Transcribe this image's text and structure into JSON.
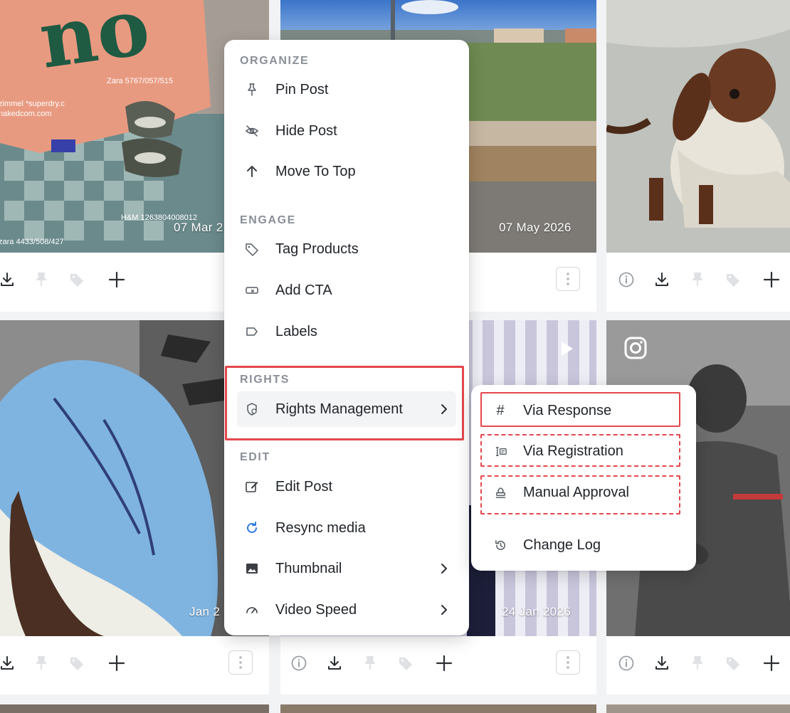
{
  "posts": [
    {
      "date": "07 Mar 2"
    },
    {
      "date": "07 May 2026"
    },
    {
      "date": ""
    },
    {
      "date": "Jan 2"
    },
    {
      "date": "24 Jan 2026"
    },
    {
      "date": ""
    }
  ],
  "post_texts": {
    "shirt_big_word": "no",
    "shirt_line1": "Zara 5767/057/515",
    "shirt_line2": "zimmel *superdry.c",
    "shirt_line3": "nakedcom.com",
    "pants_tag": "H&M 1263804008012",
    "pants_code": "zara 4433/508/427",
    "tshirt_text": "———"
  },
  "menu": {
    "sections": [
      {
        "title": "ORGANIZE",
        "items": [
          {
            "label": "Pin Post",
            "icon": "pin-icon"
          },
          {
            "label": "Hide Post",
            "icon": "eye-off-icon"
          },
          {
            "label": "Move To Top",
            "icon": "arrow-up-icon"
          }
        ]
      },
      {
        "title": "ENGAGE",
        "items": [
          {
            "label": "Tag Products",
            "icon": "tag-icon"
          },
          {
            "label": "Add CTA",
            "icon": "cta-icon"
          },
          {
            "label": "Labels",
            "icon": "label-icon"
          }
        ]
      },
      {
        "title": "RIGHTS",
        "items": [
          {
            "label": "Rights Management",
            "icon": "rights-icon",
            "has_submenu": true
          }
        ]
      },
      {
        "title": "EDIT",
        "items": [
          {
            "label": "Edit Post",
            "icon": "edit-icon"
          },
          {
            "label": "Resync media",
            "icon": "refresh-icon"
          },
          {
            "label": "Thumbnail",
            "icon": "image-icon",
            "has_submenu": true
          },
          {
            "label": "Video Speed",
            "icon": "speed-icon",
            "has_submenu": true
          }
        ]
      }
    ]
  },
  "submenu": {
    "items": [
      {
        "label": "Via Response",
        "icon": "hashtag-icon",
        "glyph": "#"
      },
      {
        "label": "Via Registration",
        "icon": "registration-icon"
      },
      {
        "label": "Manual Approval",
        "icon": "stamp-icon"
      },
      {
        "label": "Change Log",
        "icon": "history-icon"
      }
    ]
  },
  "colors": {
    "accent_red": "#e5484d",
    "resync_blue": "#2f7de1",
    "section_grey": "#8a8f98",
    "text_dark": "#1f2328"
  }
}
